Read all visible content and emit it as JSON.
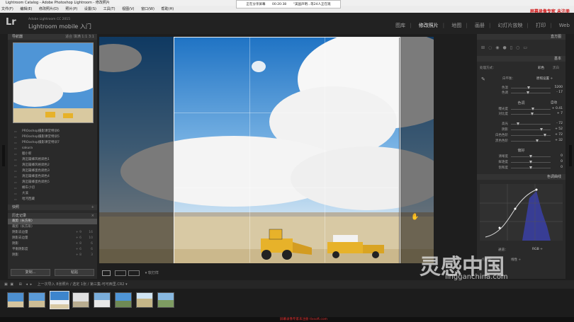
{
  "window": {
    "title": "Lightroom Catalog - Adobe Photoshop Lightroom - 修改照片"
  },
  "menu": [
    "文件(F)",
    "编辑(E)",
    "修改照片(D)",
    "照片(P)",
    "设置(S)",
    "工具(T)",
    "视图(V)",
    "窗口(W)",
    "帮助(H)"
  ],
  "recording": {
    "label": "正在分享屏幕",
    "time": "00:20:38",
    "audience": "“美国声明...等24人正在观"
  },
  "watermark_top": "屏幕录像专家 未注册",
  "identity": {
    "logo": "Lr",
    "line1": "Adobe Lightroom CC 2015",
    "line2": "Lightroom mobile 入门"
  },
  "modules": [
    "图库",
    "修改照片",
    "地图",
    "画册",
    "幻灯片放映",
    "打印",
    "Web"
  ],
  "left": {
    "navigator": {
      "title": "导航器",
      "options": "适合  填满  1:1  3:1"
    },
    "presets": [
      "PROoshop摄影课堂特训6",
      "PROoshop摄影课堂特训5",
      "PROoshop摄影课堂特训7",
      "sakura",
      "胭小新",
      "清迈篇蜂风格调色1",
      "清迈篇蜂风格调色2",
      "清迈篇蜂蛋色调色3",
      "清迈篇蜂蛋色调色4",
      "清迈篇蜂蛋色调色5",
      "橘车小切",
      "大溪",
      "哈河西藏"
    ],
    "snapshots": {
      "title": "快照"
    },
    "history": {
      "title": "历史记录",
      "items": [
        {
          "label": "裁剪（长方形）",
          "v1": "",
          "v2": "",
          "sel": true
        },
        {
          "label": "裁剪（长方形）",
          "v1": "",
          "v2": ""
        },
        {
          "label": "阴影去边量",
          "v1": "+ 9",
          "v2": "16"
        },
        {
          "label": "阴影去边量",
          "v1": "+ 6",
          "v2": "10"
        },
        {
          "label": "阴影",
          "v1": "+ 8",
          "v2": "6"
        },
        {
          "label": "平衡阴影度",
          "v1": "+ 6",
          "v2": "6"
        },
        {
          "label": "阴影",
          "v1": "+ 8",
          "v2": "3"
        }
      ]
    },
    "copy": "复制...",
    "paste": "粘贴"
  },
  "toolbar": {
    "label": "▾ 软打样"
  },
  "right": {
    "histogram": "直方图",
    "basic": {
      "title": "基本",
      "treatment_label": "处理方式：",
      "treatment_color": "彩色",
      "treatment_bw": "黑白",
      "wb": {
        "label": "白平衡：",
        "value": "原照设置 ÷"
      },
      "tone_label": "色调",
      "auto": "自动",
      "presence_label": "偏好",
      "rows": [
        {
          "label": "色温",
          "value": "5200",
          "pos": 0.45
        },
        {
          "label": "色调",
          "value": "- 17",
          "pos": 0.42
        },
        {
          "label": "曝光度",
          "value": "+ 0.41",
          "pos": 0.55
        },
        {
          "label": "对比度",
          "value": "+ 7",
          "pos": 0.53
        },
        {
          "label": "高光",
          "value": "- 72",
          "pos": 0.18
        },
        {
          "label": "阴影",
          "value": "+ 52",
          "pos": 0.76
        },
        {
          "label": "白色色阶",
          "value": "+ 72",
          "pos": 0.85
        },
        {
          "label": "黑色色阶",
          "value": "+ 32",
          "pos": 0.66
        },
        {
          "label": "清晰度",
          "value": "0",
          "pos": 0.5
        },
        {
          "label": "鲜艳度",
          "value": "0",
          "pos": 0.5
        },
        {
          "label": "饱和度",
          "value": "0",
          "pos": 0.5
        }
      ]
    },
    "tone_curve": {
      "title": "色调曲线",
      "channel_label": "通道：",
      "channel_value": "RGB ÷",
      "point_curve": "点曲线：",
      "point_value": "线性 ÷"
    }
  },
  "filmbar": {
    "text": "上一次导入  8张照片 / 选定 1张 / 第三集-可可西里.CR2 ▾"
  },
  "bottom_text": "屏幕录像专家未注册  tlxsoft.com",
  "site": {
    "logo": "灵感中国",
    "url": "lingganchina.com"
  },
  "colors": {
    "sky": "#2f86d2",
    "cloud": "#ffffff",
    "ground": "#d8c9a4",
    "truck": "#e7b22a"
  }
}
